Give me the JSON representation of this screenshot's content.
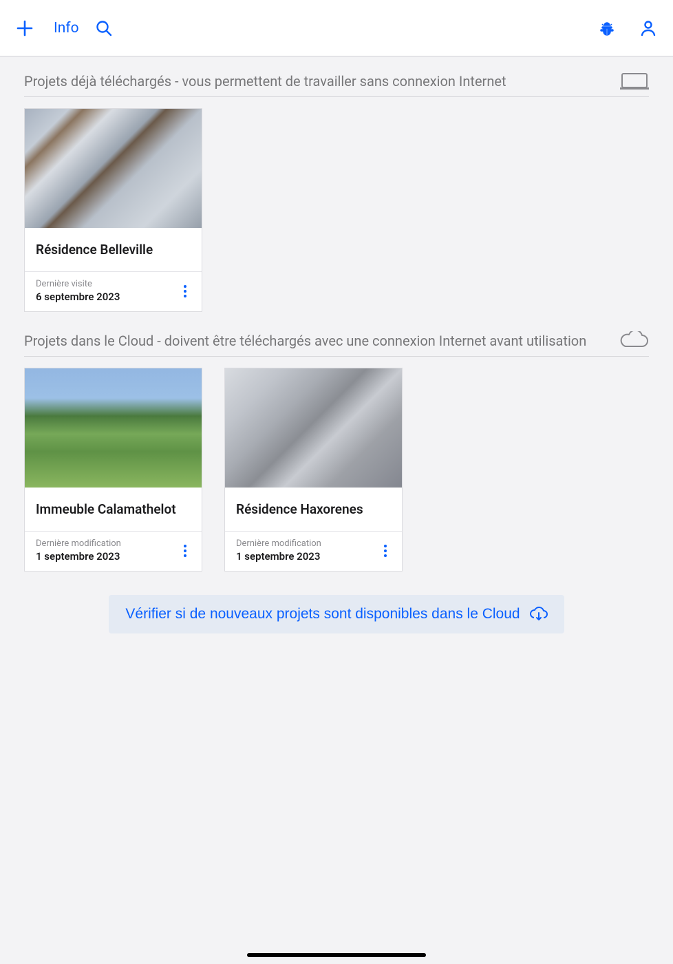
{
  "header": {
    "info_label": "Info"
  },
  "sections": {
    "downloaded": {
      "title": "Projets déjà téléchargés - vous permettent de travailler sans connexion Internet"
    },
    "cloud": {
      "title": "Projets dans le Cloud - doivent être téléchargés avec une connexion Internet avant utilisation"
    }
  },
  "projects_downloaded": [
    {
      "title": "Résidence Belleville",
      "meta_label": "Dernière visite",
      "meta_value": "6 septembre 2023"
    }
  ],
  "projects_cloud": [
    {
      "title": "Immeuble Calamathelot",
      "meta_label": "Dernière modification",
      "meta_value": "1 septembre 2023"
    },
    {
      "title": "Résidence Haxorenes",
      "meta_label": "Dernière modification",
      "meta_value": "1 septembre 2023"
    }
  ],
  "check_cloud_label": "Vérifier si de nouveaux projets sont disponibles dans le Cloud"
}
